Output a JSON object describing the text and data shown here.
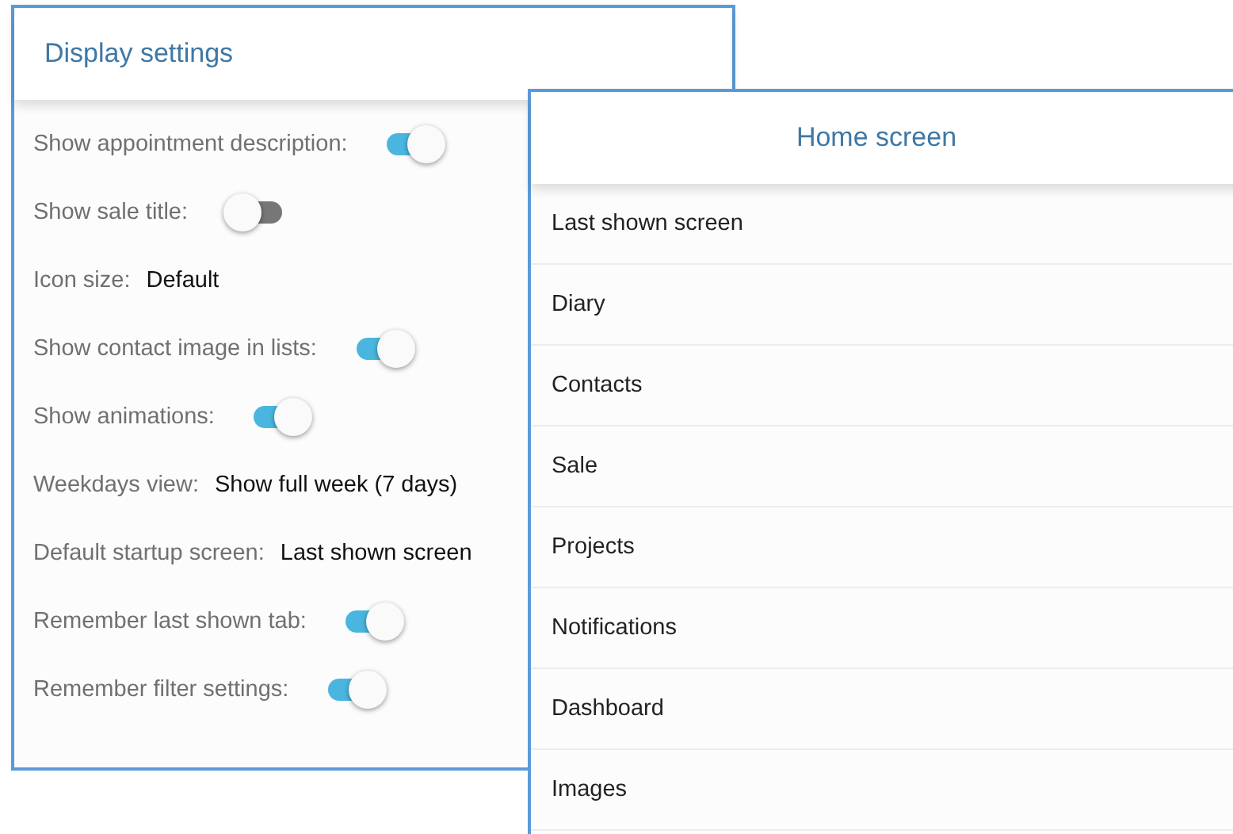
{
  "display_settings": {
    "title": "Display settings",
    "items": [
      {
        "kind": "toggle",
        "label": "Show appointment description:",
        "on": true
      },
      {
        "kind": "toggle",
        "label": "Show sale title:",
        "on": false
      },
      {
        "kind": "value",
        "label": "Icon size:",
        "value": "Default"
      },
      {
        "kind": "toggle",
        "label": "Show contact image in lists:",
        "on": true
      },
      {
        "kind": "toggle",
        "label": "Show animations:",
        "on": true
      },
      {
        "kind": "value",
        "label": "Weekdays view:",
        "value": "Show full week (7 days)"
      },
      {
        "kind": "value",
        "label": "Default startup screen:",
        "value": "Last shown screen"
      },
      {
        "kind": "toggle",
        "label": "Remember last shown tab:",
        "on": true
      },
      {
        "kind": "toggle",
        "label": "Remember filter settings:",
        "on": true
      }
    ]
  },
  "home_screen": {
    "title": "Home screen",
    "options": [
      "Last shown screen",
      "Diary",
      "Contacts",
      "Sale",
      "Projects",
      "Notifications",
      "Dashboard",
      "Images"
    ]
  }
}
